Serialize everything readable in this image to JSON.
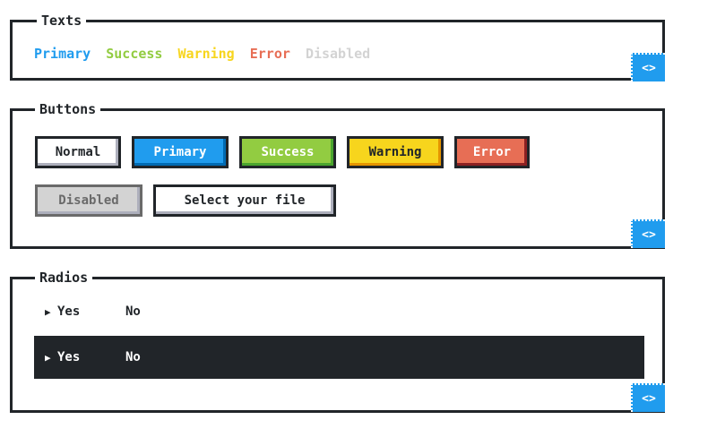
{
  "texts": {
    "title": "Texts",
    "items": [
      {
        "label": "Primary",
        "color": "#209cee"
      },
      {
        "label": "Success",
        "color": "#92cc41"
      },
      {
        "label": "Warning",
        "color": "#f7d51d"
      },
      {
        "label": "Error",
        "color": "#e76e55"
      },
      {
        "label": "Disabled",
        "color": "#d3d3d3"
      }
    ],
    "code_icon": "<>"
  },
  "buttons": {
    "title": "Buttons",
    "normal": "Normal",
    "primary": "Primary",
    "success": "Success",
    "warning": "Warning",
    "error": "Error",
    "disabled": "Disabled",
    "file": "Select your file",
    "code_icon": "<>"
  },
  "radios": {
    "title": "Radios",
    "light": {
      "yes": "Yes",
      "no": "No",
      "selected": "Yes"
    },
    "dark": {
      "yes": "Yes",
      "no": "No",
      "selected": "Yes"
    },
    "code_icon": "<>"
  },
  "colors": {
    "primary": "#209cee",
    "success": "#92cc41",
    "warning": "#f7d51d",
    "error": "#e76e55",
    "disabled": "#d3d3d3",
    "dark": "#212529"
  }
}
